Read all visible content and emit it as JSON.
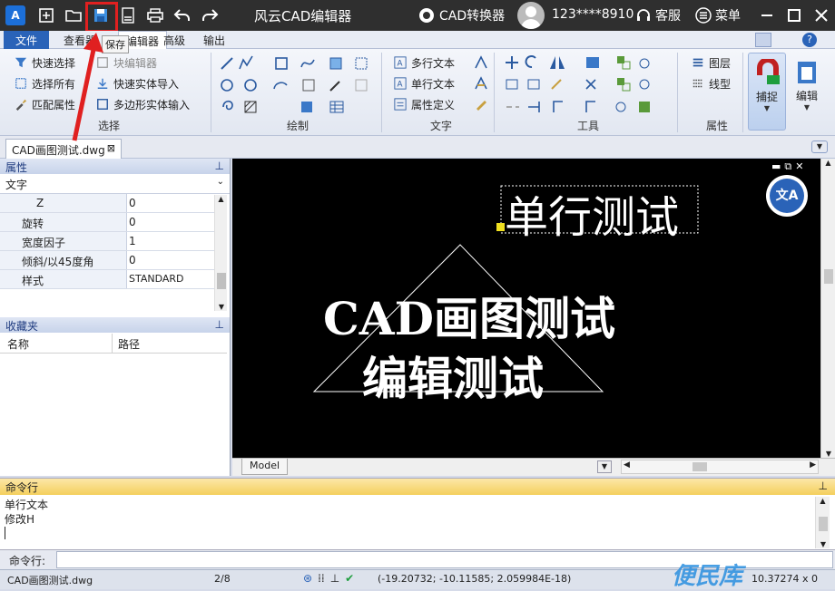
{
  "titlebar": {
    "app_title": "风云CAD编辑器",
    "converter_label": "CAD转换器",
    "user_phone": "123****8910",
    "service_label": "客服",
    "menu_label": "菜单",
    "save_tooltip": "保存"
  },
  "ribbon_tabs": [
    "文件",
    "查看器",
    "编辑器",
    "高级",
    "输出"
  ],
  "ribbon": {
    "select": {
      "group_label": "选择",
      "quick_select": "快速选择",
      "block_editor": "块编辑器",
      "select_all": "选择所有",
      "quick_import": "快速实体导入",
      "match_props": "匹配属性",
      "polygon_import": "多边形实体输入"
    },
    "draw": {
      "group_label": "绘制"
    },
    "text": {
      "group_label": "文字",
      "mtext": "多行文本",
      "stext": "单行文本",
      "attdef": "属性定义"
    },
    "tools": {
      "group_label": "工具"
    },
    "props": {
      "group_label": "属性",
      "layer": "图层",
      "linetype": "线型",
      "snap": "捕捉",
      "edit": "编辑"
    }
  },
  "document_tab": "CAD画图测试.dwg",
  "properties_panel": {
    "title": "属性",
    "object_type": "文字",
    "rows": [
      {
        "key": "Z",
        "value": "0"
      },
      {
        "key": "旋转",
        "value": "0"
      },
      {
        "key": "宽度因子",
        "value": "1"
      },
      {
        "key": "倾斜/以45度角",
        "value": "0"
      },
      {
        "key": "样式",
        "value": "STANDARD"
      }
    ]
  },
  "favorites_panel": {
    "title": "收藏夹",
    "col_name": "名称",
    "col_path": "路径"
  },
  "drawing": {
    "single_line_text": "单行测试",
    "main_text": "CAD画图测试",
    "edit_text": "编辑测试",
    "model_tab": "Model"
  },
  "command": {
    "title": "命令行",
    "log": [
      "单行文本",
      "修改H"
    ],
    "prompt_label": "命令行:"
  },
  "status": {
    "filename": "CAD画图测试.dwg",
    "pages": "2/8",
    "coords": "(-19.20732; -10.11585; 2.059984E-18)",
    "size": "10.37274 x 0"
  },
  "watermark": "便民库",
  "colors": {
    "accent": "#2a63b8",
    "annotation_red": "#e02020"
  }
}
